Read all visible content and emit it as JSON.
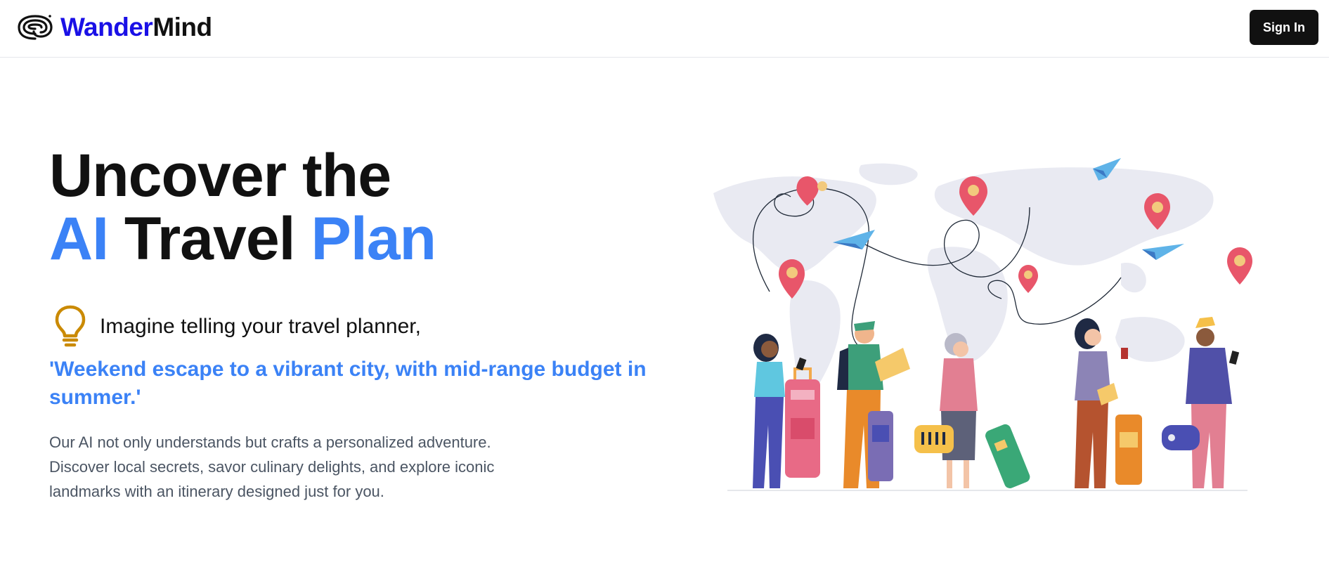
{
  "header": {
    "brand_part1": "Wander",
    "brand_part2": "Mind",
    "logo_icon": "brain-loop-icon",
    "signin_label": "Sign In"
  },
  "hero": {
    "title_line1": "Uncover the",
    "title_ai": "AI",
    "title_travel": "Travel",
    "title_plan": "Plan",
    "bulb_icon": "lightbulb-icon",
    "lead": "Imagine telling your travel planner,",
    "quote": "'Weekend escape to a vibrant city, with mid-range budget in summer.'",
    "desc_line1": "Our AI not only understands but crafts a personalized adventure.",
    "desc_line2": "Discover local secrets, savor culinary delights, and explore iconic",
    "desc_line3": "landmarks with an itinerary designed just for you."
  },
  "colors": {
    "accent_blue": "#3b82f6",
    "brand_blue": "#1a10e6",
    "bulb_gold": "#ca8a04"
  }
}
